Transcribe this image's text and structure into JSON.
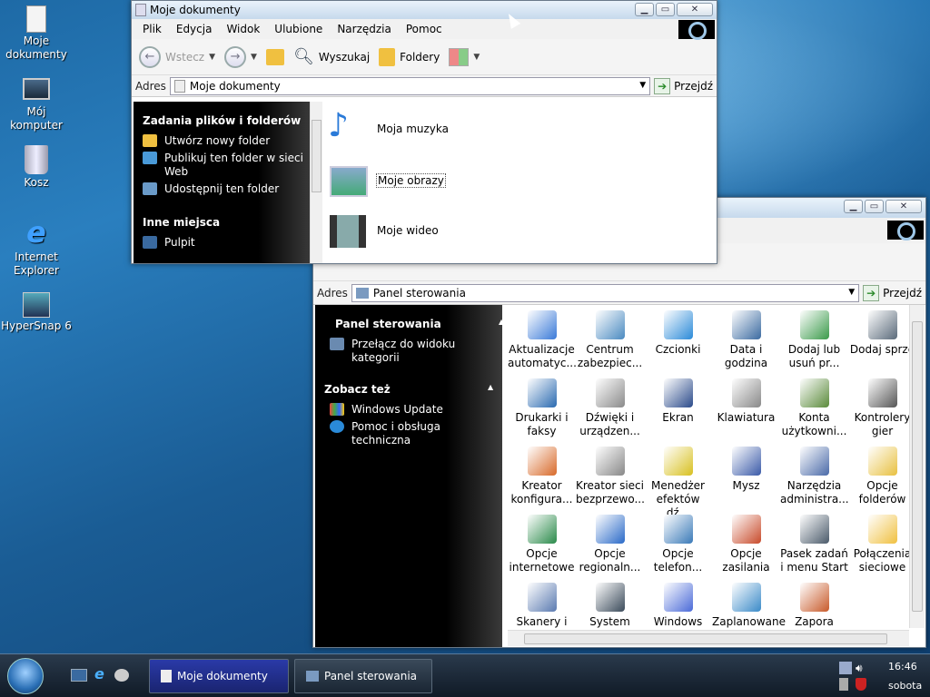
{
  "desktop": {
    "icons": [
      {
        "label": "Moje dokumenty",
        "icon": "documents-icon"
      },
      {
        "label": "Mój komputer",
        "icon": "computer-icon"
      },
      {
        "label": "Kosz",
        "icon": "recycle-bin-icon"
      },
      {
        "label": "Internet Explorer",
        "icon": "ie-icon"
      },
      {
        "label": "HyperSnap 6",
        "icon": "hypersnap-icon"
      }
    ]
  },
  "win1": {
    "title": "Moje dokumenty",
    "menu": [
      "Plik",
      "Edycja",
      "Widok",
      "Ulubione",
      "Narzędzia",
      "Pomoc"
    ],
    "back": "Wstecz",
    "search": "Wyszukaj",
    "folders": "Foldery",
    "address_label": "Adres",
    "address": "Moje dokumenty",
    "go": "Przejdź",
    "side_title1": "Zadania plików i folderów",
    "tasks": [
      "Utwórz nowy folder",
      "Publikuj ten folder w sieci Web",
      "Udostępnij ten folder"
    ],
    "side_title2": "Inne miejsca",
    "places": [
      "Pulpit"
    ],
    "items": [
      "Moja muzyka",
      "Moje obrazy",
      "Moje wideo"
    ]
  },
  "win2": {
    "address_label": "Adres",
    "address": "Panel sterowania",
    "go": "Przejdź",
    "side_title1": "Panel sterowania",
    "switch_view": "Przełącz do widoku kategorii",
    "side_title2": "Zobacz też",
    "see_also": [
      "Windows Update",
      "Pomoc i obsługa techniczna"
    ],
    "items": [
      "Aktualizacje automatyc...",
      "Centrum zabezpiec...",
      "Czcionki",
      "Data i godzina",
      "Dodaj lub usuń pr...",
      "Dodaj sprzę",
      "Drukarki i faksy",
      "Dźwięki i urządzen...",
      "Ekran",
      "Klawiatura",
      "Konta użytkowni...",
      "Kontrolery gier",
      "Kreator konfigura...",
      "Kreator sieci bezprzewo...",
      "Menedżer efektów dź...",
      "Mysz",
      "Narzędzia administra...",
      "Opcje folderów",
      "Opcje internetowe",
      "Opcje regionaln...",
      "Opcje telefon...",
      "Opcje zasilania",
      "Pasek zadań i menu Start",
      "Połączenia sieciowe",
      "Skanery i aparaty fotograficzne",
      "System",
      "Windows CardSpace",
      "Zaplanowane zadania",
      "Zapora systemu Windows"
    ]
  },
  "taskbar": {
    "tasks": [
      "Moje dokumenty",
      "Panel sterowania"
    ],
    "time": "16:46",
    "day": "sobota"
  }
}
